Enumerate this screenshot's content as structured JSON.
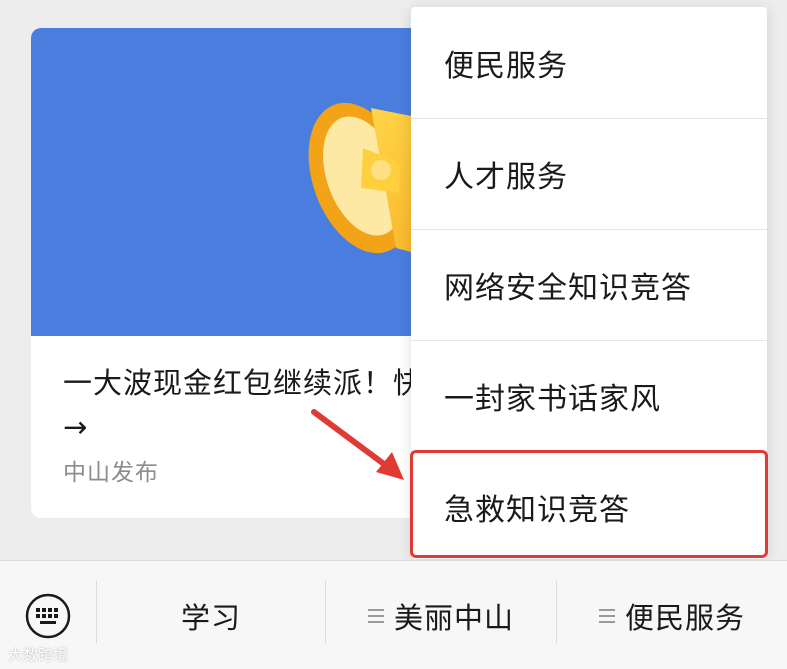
{
  "article_card": {
    "title": "一大波现金红包继续派！快来 →",
    "source": "中山发布",
    "banner_color": "#4a7ede"
  },
  "popup_menu": {
    "items": [
      {
        "label": "便民服务"
      },
      {
        "label": "人才服务"
      },
      {
        "label": "网络安全知识竞答"
      },
      {
        "label": "一封家书话家风"
      },
      {
        "label": "急救知识竞答"
      }
    ],
    "highlight_color": "#e03a34"
  },
  "bottom_menu": {
    "keyboard_icon": "keyboard-icon",
    "tabs": [
      {
        "label": "学习"
      },
      {
        "label": "美丽中山"
      },
      {
        "label": "便民服务"
      }
    ]
  },
  "watermark": "大数跨境"
}
